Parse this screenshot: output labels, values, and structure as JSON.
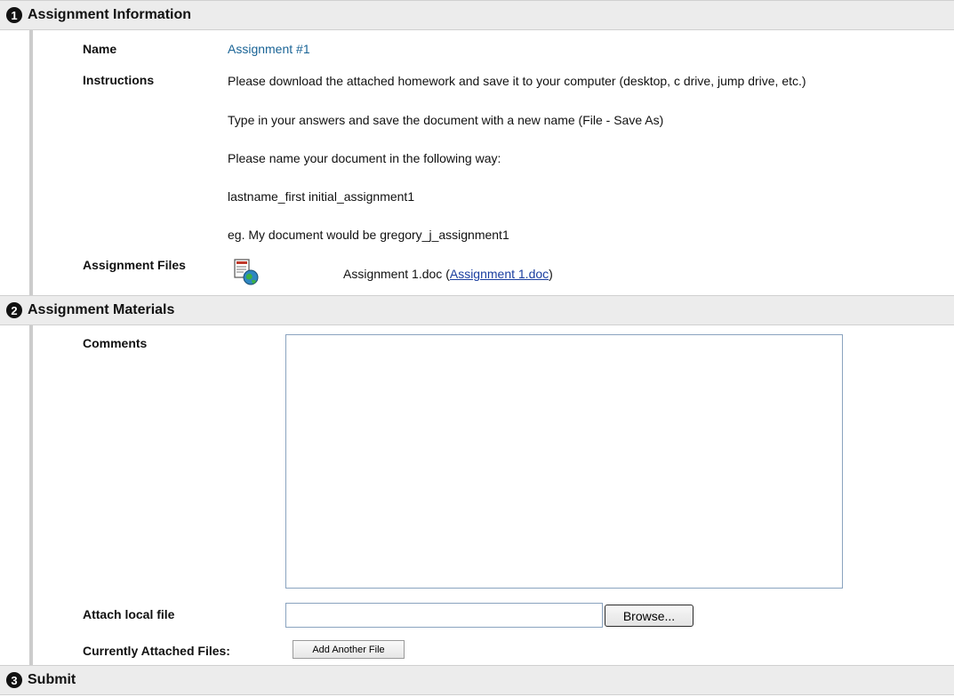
{
  "sections": {
    "info": {
      "number": "1",
      "title": "Assignment Information"
    },
    "materials": {
      "number": "2",
      "title": "Assignment Materials"
    },
    "submit": {
      "number": "3",
      "title": "Submit"
    }
  },
  "info": {
    "name_label": "Name",
    "name_value": "Assignment #1",
    "instructions_label": "Instructions",
    "instructions": [
      "Please download the attached homework and save it to your computer (desktop, c drive, jump drive, etc.)",
      "Type in your answers and save the document with a new name (File - Save As)",
      "Please name your document in the following way:",
      "lastname_first initial_assignment1",
      "eg. My document would be gregory_j_assignment1"
    ],
    "files_label": "Assignment Files",
    "file_name": "Assignment 1.doc",
    "file_paren_open": "(",
    "file_link": "Assignment 1.doc",
    "file_paren_close": ")",
    "file_icon": "document-globe-icon"
  },
  "materials": {
    "comments_label": "Comments",
    "comments_value": "",
    "attach_label": "Attach local file",
    "attach_value": "",
    "browse_label": "Browse...",
    "attached_label": "Currently Attached Files:",
    "add_file_label": "Add Another File"
  }
}
